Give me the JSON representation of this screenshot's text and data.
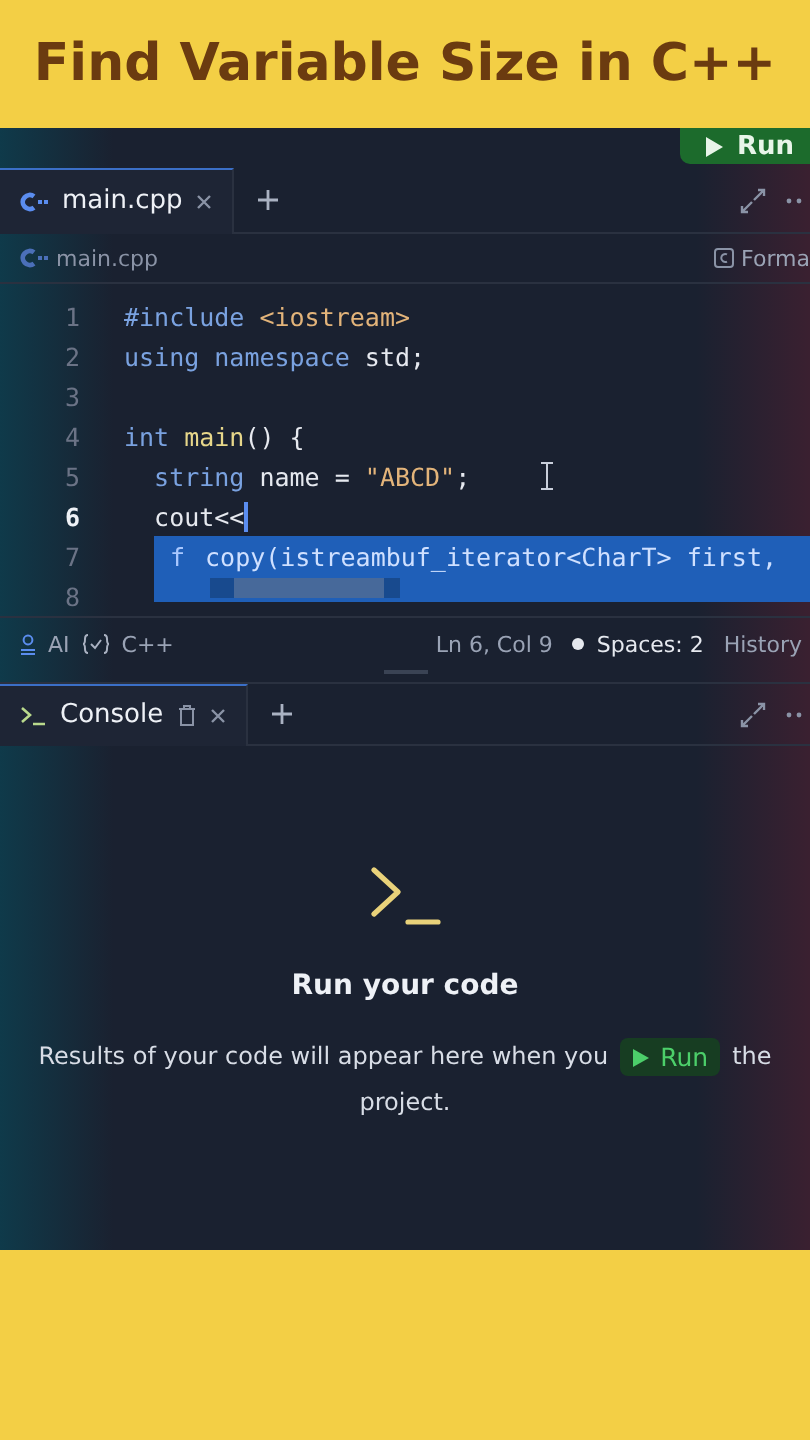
{
  "banner": {
    "title": "Find Variable Size in C++"
  },
  "top_run_button": {
    "label": "Run"
  },
  "editor_tabs": [
    {
      "label": "main.cpp",
      "selected": true
    }
  ],
  "breadcrumb": {
    "file": "main.cpp",
    "format_button": "Forma"
  },
  "code_lines": [
    {
      "number": "1",
      "current": false,
      "tokens": [
        {
          "text": "#include ",
          "kind": "keyword"
        },
        {
          "text": "<iostream>",
          "kind": "string"
        }
      ]
    },
    {
      "number": "2",
      "current": false,
      "tokens": [
        {
          "text": "using namespace ",
          "kind": "keyword"
        },
        {
          "text": "std;",
          "kind": "plain"
        }
      ]
    },
    {
      "number": "3",
      "current": false
    },
    {
      "number": "4",
      "current": false,
      "tokens": [
        {
          "text": "int ",
          "kind": "keyword"
        },
        {
          "text": "main",
          "kind": "function"
        },
        {
          "text": "() {",
          "kind": "plain"
        }
      ]
    },
    {
      "number": "5",
      "current": false,
      "tokens": [
        {
          "text": "  string ",
          "kind": "keyword"
        },
        {
          "text": "name = ",
          "kind": "plain"
        },
        {
          "text": "\"ABCD\"",
          "kind": "string"
        },
        {
          "text": ";",
          "kind": "plain"
        }
      ]
    },
    {
      "number": "6",
      "current": true,
      "tokens": [
        {
          "text": "  cout<<",
          "kind": "plain"
        }
      ]
    },
    {
      "number": "7",
      "current": false
    },
    {
      "number": "8",
      "current": false
    }
  ],
  "autocomplete": {
    "kind_letter": "f",
    "suggestion": "copy(istreambuf_iterator<CharT> first,"
  },
  "status_bar": {
    "ai": "AI",
    "language": "C++",
    "position": "Ln 6, Col 9",
    "spaces": "Spaces: 2",
    "history": "History"
  },
  "console_tabs": [
    {
      "label": "Console",
      "selected": true
    }
  ],
  "console": {
    "heading": "Run your code",
    "message_before": "Results of your code will appear here when you",
    "run_label": "Run",
    "message_after": "the",
    "message_end": "project."
  }
}
